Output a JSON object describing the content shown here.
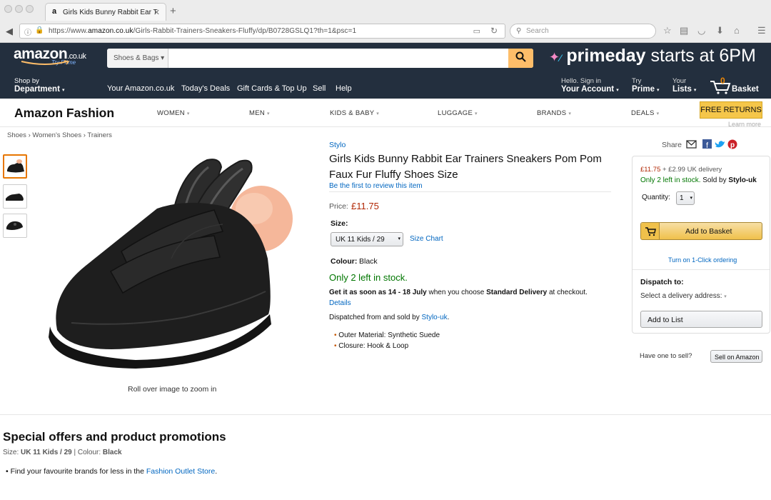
{
  "browser": {
    "tab_title": "Girls Kids Bunny Rabbit Ear T",
    "url_prefix": "https://www.",
    "url_host": "amazon.co.uk",
    "url_path": "/Girls-Rabbit-Trainers-Sneakers-Fluffy/dp/B0728GSLQ1?th=1&psc=1",
    "search_placeholder": "Search"
  },
  "header": {
    "logo": "amazon",
    "logo_suffix": ".co.uk",
    "try_prime": "Try Prime",
    "search_category": "Shoes & Bags",
    "prime_brand": "primeday",
    "prime_text": "starts at 6PM"
  },
  "nav": {
    "shop_by": "Shop by",
    "department": "Department",
    "links": [
      "Your Amazon.co.uk",
      "Today's Deals",
      "Gift Cards & Top Up",
      "Sell",
      "Help"
    ],
    "hello": "Hello. Sign in",
    "your_account": "Your Account",
    "try": "Try",
    "prime": "Prime",
    "your": "Your",
    "lists": "Lists",
    "basket_count": "0",
    "basket": "Basket"
  },
  "fashion": {
    "title": "Amazon Fashion",
    "menu": [
      "WOMEN",
      "MEN",
      "KIDS & BABY",
      "LUGGAGE",
      "BRANDS",
      "DEALS"
    ],
    "free_returns": "FREE RETURNS",
    "learn_more": "Learn more"
  },
  "breadcrumb": [
    "Shoes",
    "Women's Shoes",
    "Trainers"
  ],
  "gallery": {
    "zoom_hint": "Roll over image to zoom in"
  },
  "product": {
    "brand": "Stylo",
    "title_line1": "Girls Kids Bunny Rabbit Ear Trainers Sneakers Pom Pom",
    "title_line2": "Faux Fur Fluffy Shoes Size",
    "review_link": "Be the first to review this item",
    "price_label": "Price:",
    "price": "£11.75",
    "size_label": "Size:",
    "size_value": "UK 11 Kids / 29",
    "size_chart": "Size Chart",
    "colour_label": "Colour:",
    "colour_value": "Black",
    "stock": "Only 2 left in stock.",
    "delivery_bold1": "Get it as soon as 14 - 18 July",
    "delivery_mid": "when you choose",
    "delivery_bold2": "Standard Delivery",
    "delivery_end": "at checkout.",
    "details": "Details",
    "dispatched": "Dispatched from and sold by",
    "seller": "Stylo-uk",
    "bullets": [
      "Outer Material: Synthetic Suede",
      "Closure: Hook & Loop"
    ]
  },
  "buybox": {
    "share": "Share",
    "price": "£11.75",
    "delivery": "+ £2.99 UK delivery",
    "stock_line": "Only 2 left in stock.",
    "sold_by": "Sold by",
    "seller": "Stylo-uk",
    "quantity_label": "Quantity:",
    "quantity": "1",
    "add_to_basket": "Add to Basket",
    "one_click": "Turn on 1-Click ordering",
    "dispatch_to": "Dispatch to:",
    "select_address": "Select a delivery address:",
    "add_to_list": "Add to List",
    "have_one": "Have one to sell?",
    "sell_on_amazon": "Sell on Amazon"
  },
  "offers": {
    "heading": "Special offers and product promotions",
    "size_label": "Size:",
    "size_value": "UK 11 Kids / 29",
    "colour_label": "Colour:",
    "colour_value": "Black",
    "item_text": "Find your favourite brands for less in the",
    "item_link": "Fashion Outlet Store",
    "item_end": "."
  },
  "colors": {
    "nav_bg": "#232f3e",
    "accent_orange": "#febd69",
    "price_red": "#b12704",
    "link_blue": "#0066c0",
    "stock_green": "#007600"
  }
}
